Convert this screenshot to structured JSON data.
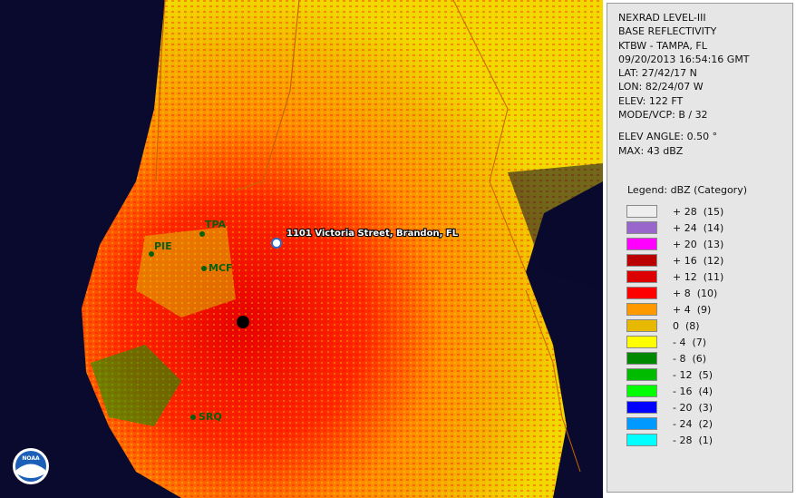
{
  "map": {
    "address_label": "1101 Victoria Street, Brandon, FL",
    "city_labels": [
      {
        "id": "tpa",
        "text": "TPA"
      },
      {
        "id": "pie",
        "text": "PIE"
      },
      {
        "id": "mcf",
        "text": "MCF"
      },
      {
        "id": "srq",
        "text": "SRQ"
      }
    ],
    "logo_text": "NOAA"
  },
  "info": {
    "product": "NEXRAD LEVEL-III",
    "type": "BASE REFLECTIVITY",
    "station": "KTBW - TAMPA, FL",
    "datetime": "09/20/2013 16:54:16 GMT",
    "lat": "LAT: 27/42/17 N",
    "lon": "LON: 82/24/07 W",
    "elev": "ELEV: 122 FT",
    "mode": "MODE/VCP: B / 32",
    "elev_angle": "ELEV ANGLE: 0.50 °",
    "max": "MAX: 43 dBZ"
  },
  "legend": {
    "title": "Legend: dBZ (Category)",
    "items": [
      {
        "label": "+ 28  (15)",
        "color": "#eeeeee"
      },
      {
        "label": "+ 24  (14)",
        "color": "#9966cc"
      },
      {
        "label": "+ 20  (13)",
        "color": "#ff00ff"
      },
      {
        "label": "+ 16  (12)",
        "color": "#bb0000"
      },
      {
        "label": "+ 12  (11)",
        "color": "#dd0000"
      },
      {
        "label": "+ 8  (10)",
        "color": "#ff0000"
      },
      {
        "label": "+ 4  (9)",
        "color": "#ff9900"
      },
      {
        "label": "0  (8)",
        "color": "#e6b800"
      },
      {
        "label": "- 4  (7)",
        "color": "#ffff00"
      },
      {
        "label": "- 8  (6)",
        "color": "#008800"
      },
      {
        "label": "- 12  (5)",
        "color": "#00bb00"
      },
      {
        "label": "- 16  (4)",
        "color": "#00ff00"
      },
      {
        "label": "- 20  (3)",
        "color": "#0000ff"
      },
      {
        "label": "- 24  (2)",
        "color": "#0099ff"
      },
      {
        "label": "- 28  (1)",
        "color": "#00ffff"
      }
    ]
  }
}
